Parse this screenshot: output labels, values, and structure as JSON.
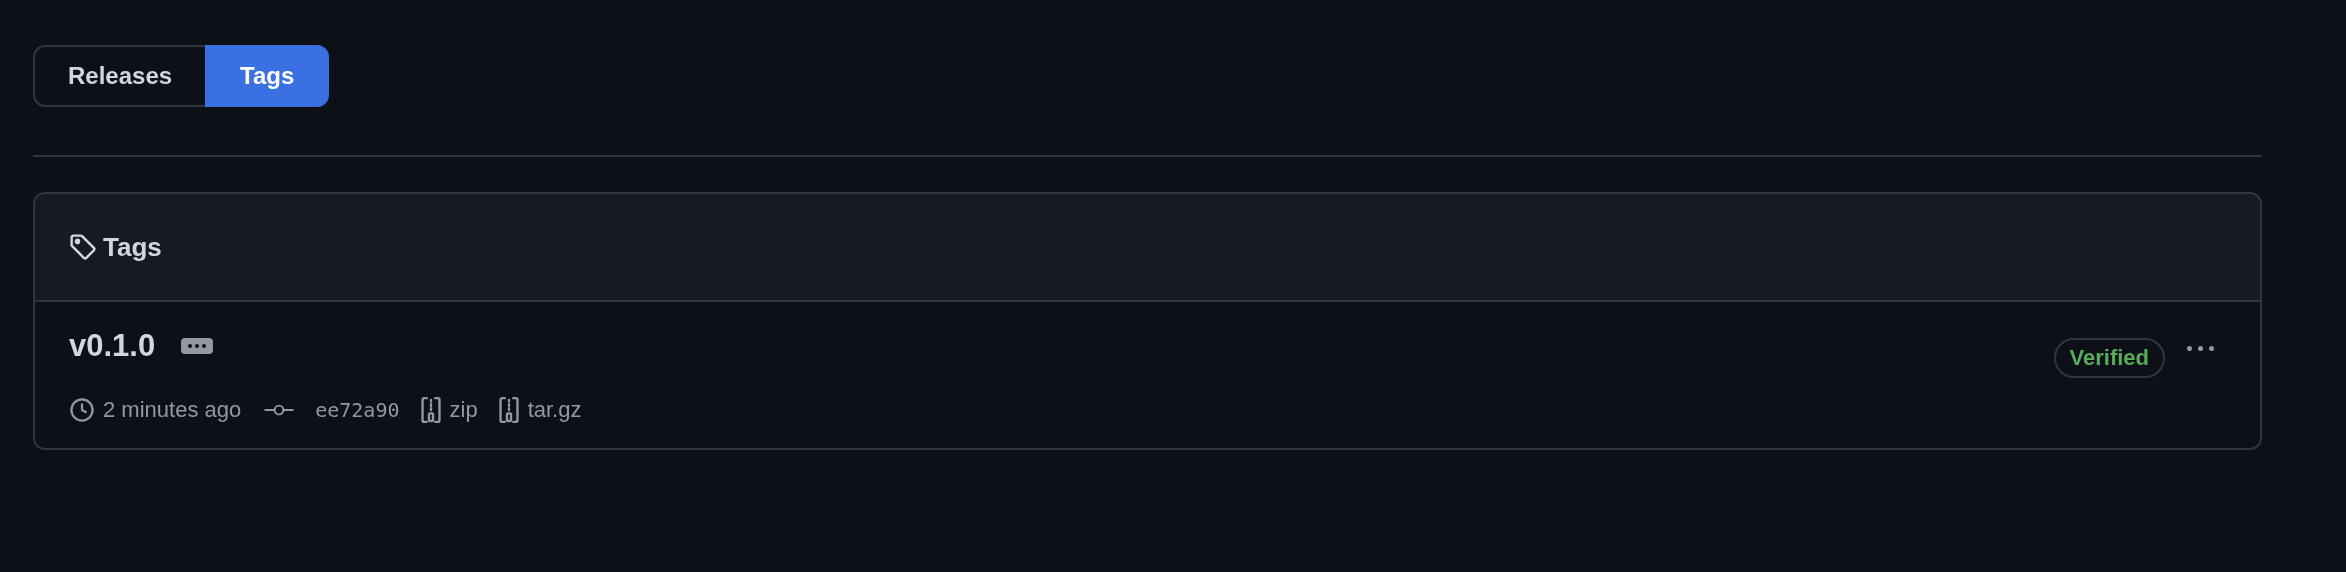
{
  "tabs": [
    {
      "label": "Releases",
      "selected": false
    },
    {
      "label": "Tags",
      "selected": true
    }
  ],
  "panel": {
    "title": "Tags",
    "tags": [
      {
        "name": "v0.1.0",
        "time": "2 minutes ago",
        "commit": "ee72a90",
        "downloads": [
          "zip",
          "tar.gz"
        ],
        "badge": "Verified"
      }
    ]
  }
}
